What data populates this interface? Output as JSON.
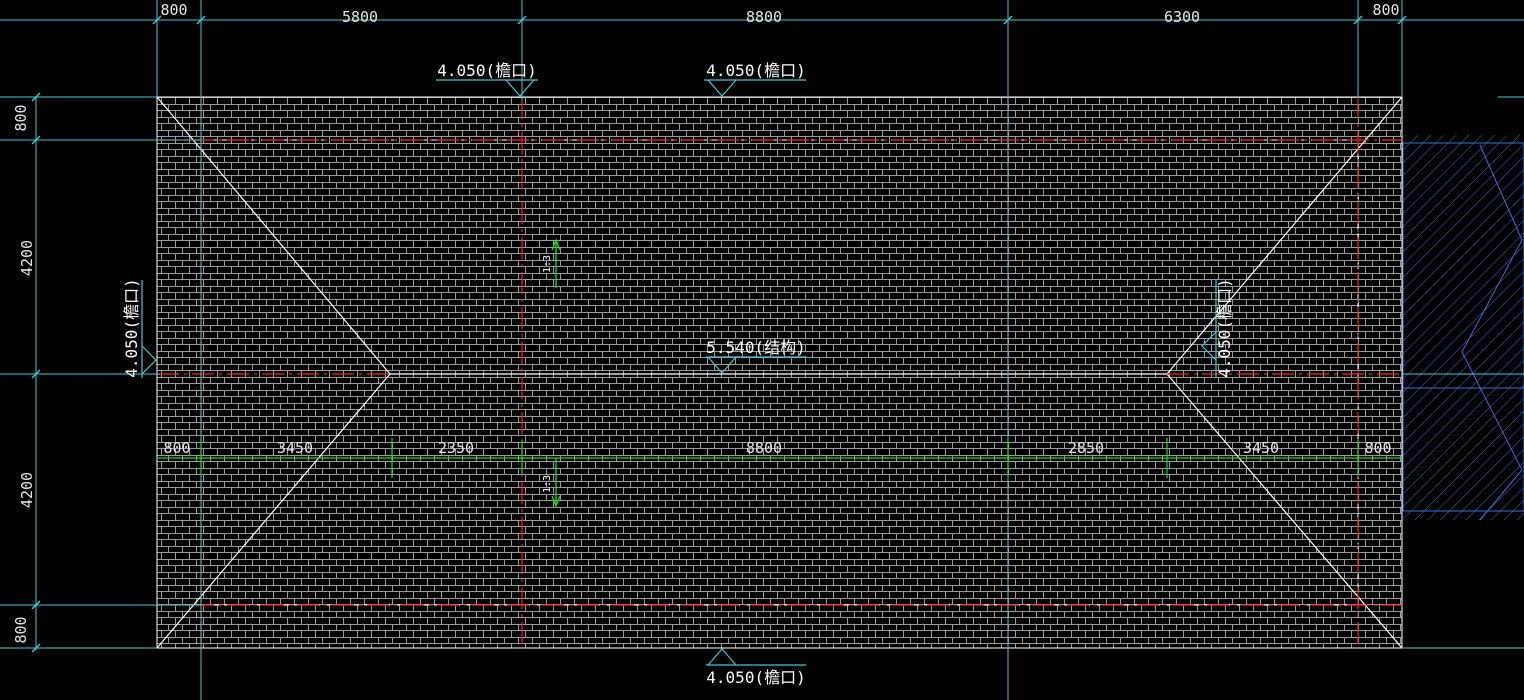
{
  "drawing": {
    "top_dims": [
      "800",
      "5800",
      "8800",
      "6300",
      "800"
    ],
    "mid_dims": [
      "800",
      "3450",
      "2350",
      "8800",
      "2850",
      "3450",
      "800"
    ],
    "left_dims": [
      "800",
      "4200",
      "4200",
      "800"
    ],
    "levels": {
      "top_left": "4.050(檐口)",
      "top_right": "4.050(檐口)",
      "ridge": "5.540(结构)",
      "bottom": "4.050(檐口)",
      "left": "4.050(檐口)",
      "right": "4.050(檐口)"
    },
    "slope_upper": "1:3",
    "slope_lower": "1:3"
  }
}
